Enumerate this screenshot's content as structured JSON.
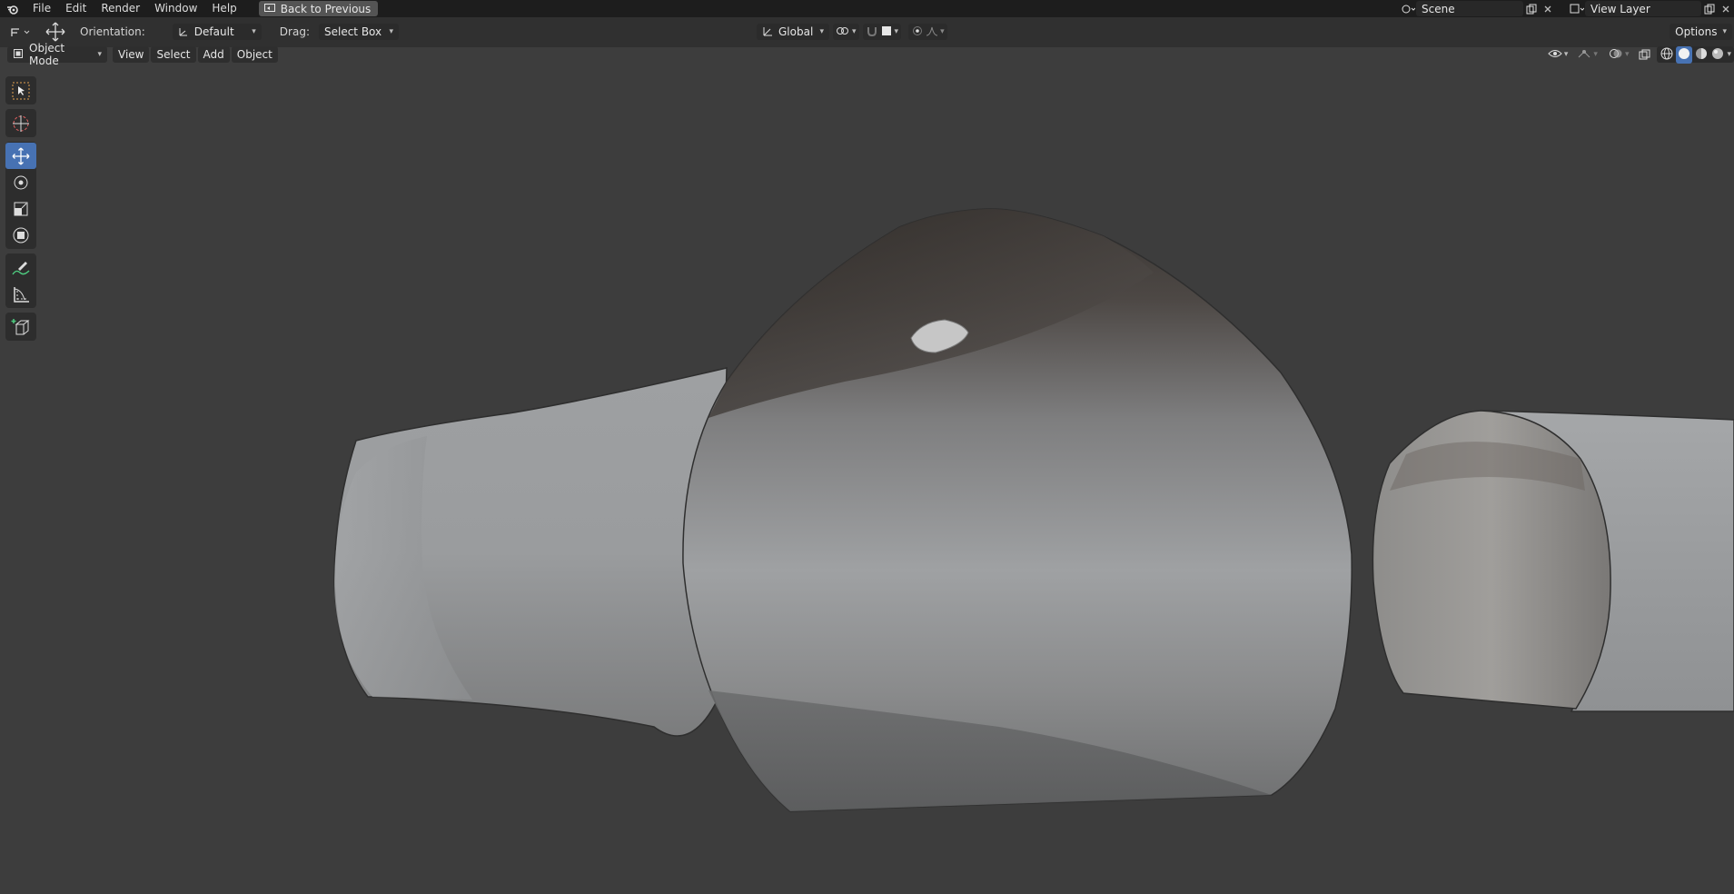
{
  "topbar": {
    "menu": [
      "File",
      "Edit",
      "Render",
      "Window",
      "Help"
    ],
    "back_button": "Back to Previous",
    "scene_name": "Scene",
    "view_layer": "View Layer"
  },
  "toolheader": {
    "orientation_label": "Orientation:",
    "orientation_value": "Default",
    "drag_label": "Drag:",
    "drag_value": "Select Box",
    "transform_orientation": "Global",
    "options_label": "Options"
  },
  "viewport_header": {
    "mode": "Object Mode",
    "menus": [
      "View",
      "Select",
      "Add",
      "Object"
    ]
  },
  "toolbar": {
    "tools": [
      "select-box",
      "cursor",
      "move",
      "rotate",
      "scale",
      "transform",
      "annotate",
      "measure",
      "add-cube"
    ],
    "active_tool": "move"
  },
  "colors": {
    "accent": "#4772b3",
    "background": "#3d3d3d",
    "topbar": "#1d1d1d",
    "header": "#303030"
  }
}
